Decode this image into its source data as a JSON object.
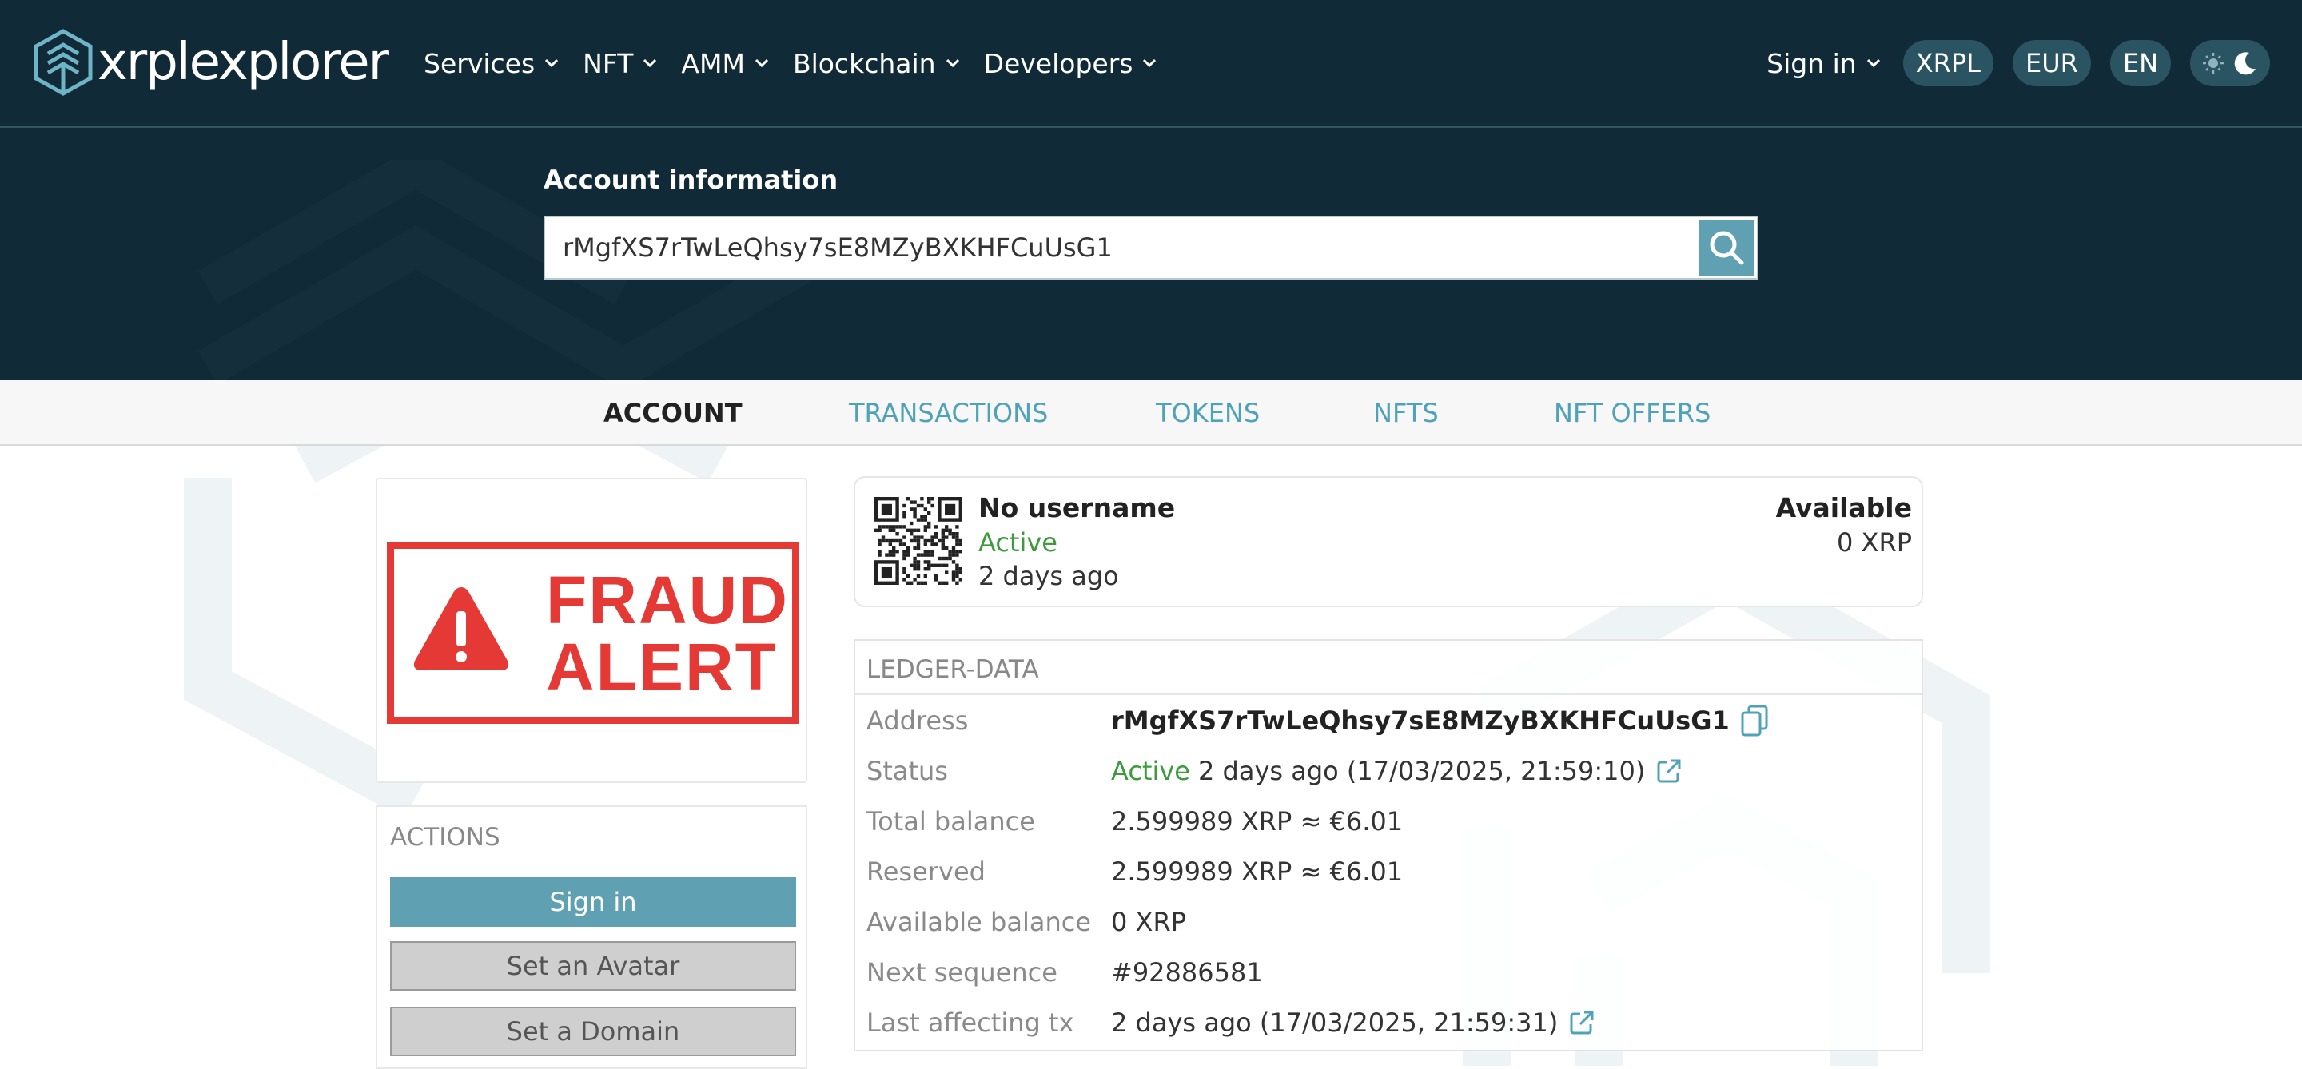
{
  "brand": {
    "name": "xrplexplorer"
  },
  "nav": {
    "items": [
      {
        "label": "Services"
      },
      {
        "label": "NFT"
      },
      {
        "label": "AMM"
      },
      {
        "label": "Blockchain"
      },
      {
        "label": "Developers"
      }
    ],
    "signin": "Sign in",
    "network": "XRPL",
    "currency": "EUR",
    "language": "EN"
  },
  "search": {
    "title": "Account information",
    "value": "rMgfXS7rTwLeQhsy7sE8MZyBXKHFCuUsG1"
  },
  "tabs": [
    {
      "label": "ACCOUNT",
      "active": true
    },
    {
      "label": "TRANSACTIONS"
    },
    {
      "label": "TOKENS"
    },
    {
      "label": "NFTS"
    },
    {
      "label": "NFT OFFERS"
    }
  ],
  "avatar": {
    "alert_line1": "FRAUD",
    "alert_line2": "ALERT"
  },
  "actions": {
    "title": "ACTIONS",
    "signin": "Sign in",
    "set_avatar": "Set an Avatar",
    "set_domain": "Set a Domain"
  },
  "summary": {
    "username": "No username",
    "status": "Active",
    "ago": "2 days ago",
    "available_label": "Available",
    "available_value": "0 XRP"
  },
  "ledger": {
    "title": "LEDGER-DATA",
    "rows": {
      "address": {
        "label": "Address",
        "value": "rMgfXS7rTwLeQhsy7sE8MZyBXKHFCuUsG1"
      },
      "status": {
        "label": "Status",
        "status": "Active",
        "value": "2 days ago (17/03/2025, 21:59:10)"
      },
      "total": {
        "label": "Total balance",
        "value": "2.599989 XRP ≈ €6.01"
      },
      "reserved": {
        "label": "Reserved",
        "value": "2.599989 XRP ≈ €6.01"
      },
      "available": {
        "label": "Available balance",
        "value": "0 XRP"
      },
      "sequence": {
        "label": "Next sequence",
        "value": "#92886581"
      },
      "last_tx": {
        "label": "Last affecting tx",
        "value": "2 days ago (17/03/2025, 21:59:31)"
      }
    }
  },
  "colors": {
    "header_bg": "#112a37",
    "accent": "#5fa0b3",
    "tab_link": "#4fa2b8",
    "active_green": "#3d9a3d",
    "alert_red": "#e53935"
  },
  "icons": {
    "logo": "hexagon-logo-icon",
    "search": "search-icon",
    "copy": "copy-icon",
    "external": "external-link-icon",
    "sun": "sun-icon",
    "moon": "moon-icon",
    "qr": "qr-code-icon",
    "warning": "warning-triangle-icon"
  }
}
